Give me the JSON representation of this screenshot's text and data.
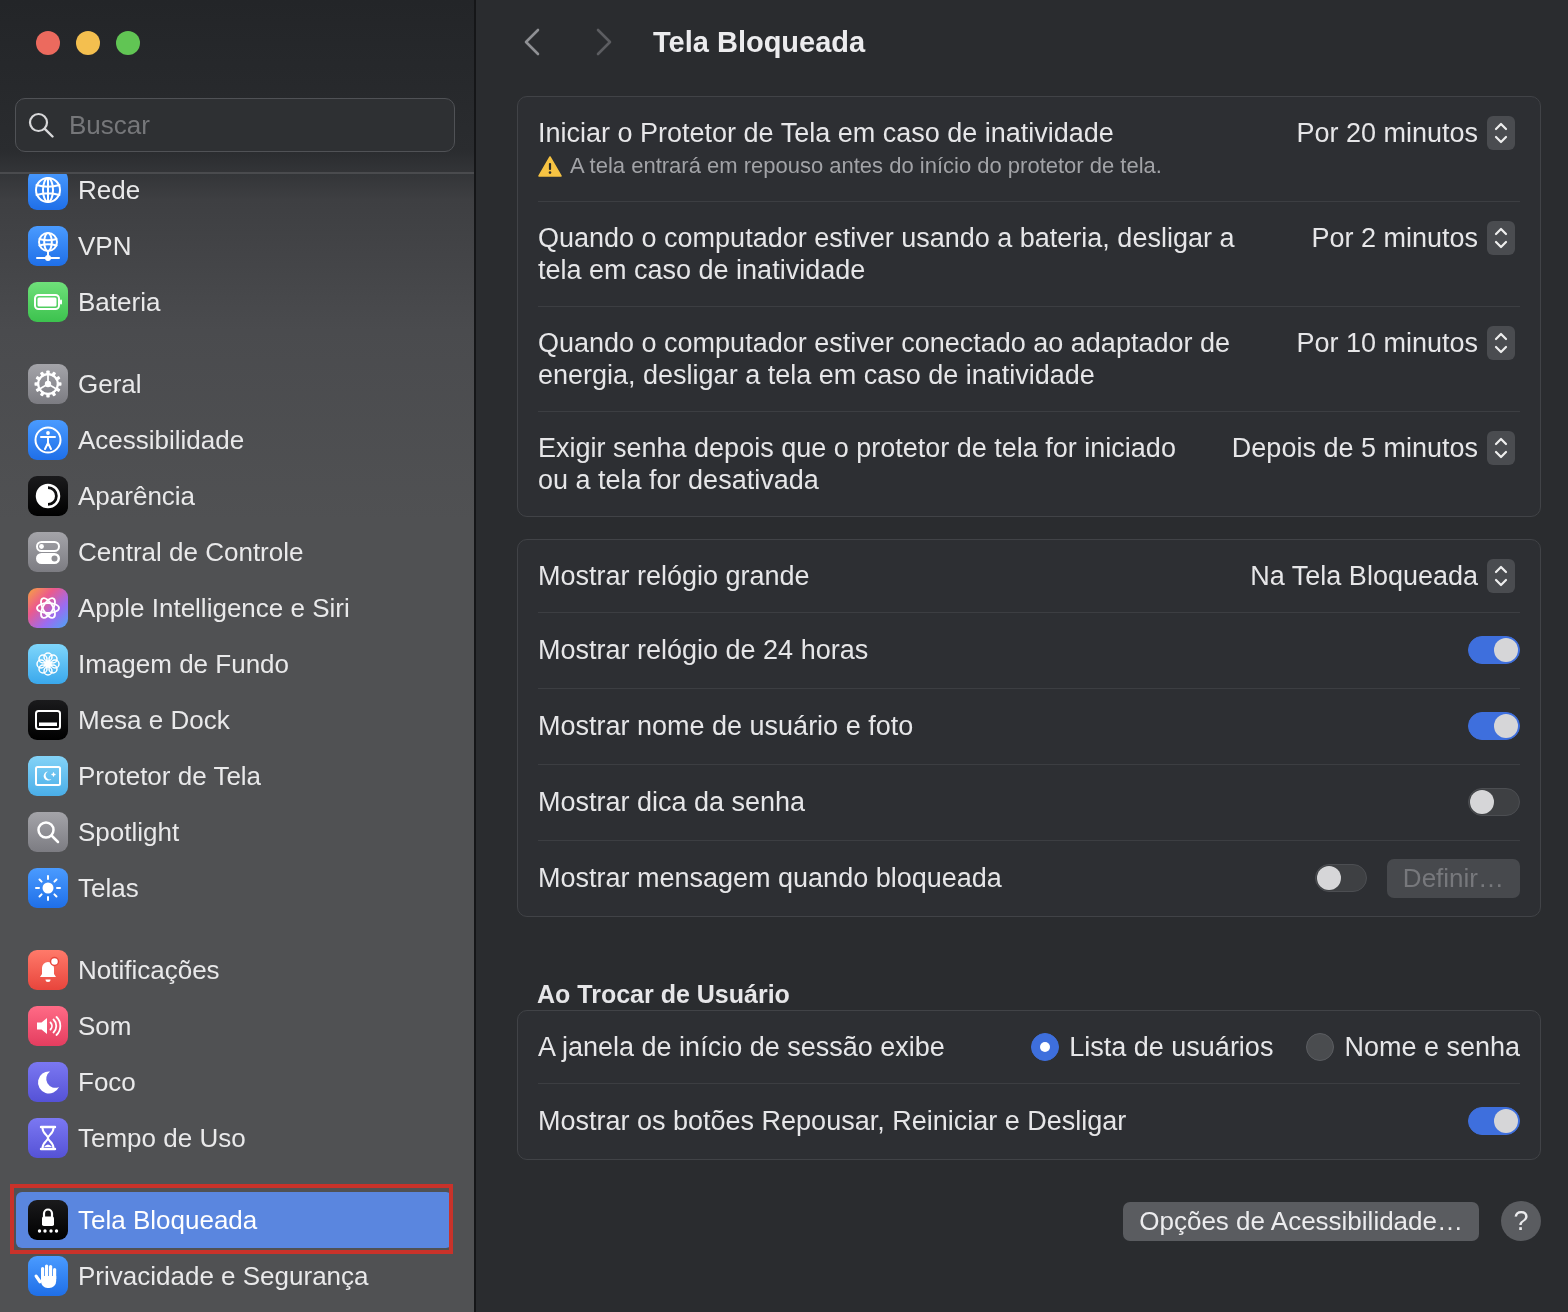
{
  "sidebar": {
    "search": {
      "placeholder": "Buscar"
    },
    "groups": [
      {
        "items": [
          {
            "label": "Rede",
            "selected": false,
            "highlighted": false
          },
          {
            "label": "VPN",
            "selected": false,
            "highlighted": false
          },
          {
            "label": "Bateria",
            "selected": false,
            "highlighted": false
          }
        ]
      },
      {
        "items": [
          {
            "label": "Geral",
            "selected": false,
            "highlighted": false
          },
          {
            "label": "Acessibilidade",
            "selected": false,
            "highlighted": false
          },
          {
            "label": "Aparência",
            "selected": false,
            "highlighted": false
          },
          {
            "label": "Central de Controle",
            "selected": false,
            "highlighted": false
          },
          {
            "label": "Apple Intelligence e Siri",
            "selected": false,
            "highlighted": false
          },
          {
            "label": "Imagem de Fundo",
            "selected": false,
            "highlighted": false
          },
          {
            "label": "Mesa e Dock",
            "selected": false,
            "highlighted": false
          },
          {
            "label": "Protetor de Tela",
            "selected": false,
            "highlighted": false
          },
          {
            "label": "Spotlight",
            "selected": false,
            "highlighted": false
          },
          {
            "label": "Telas",
            "selected": false,
            "highlighted": false
          }
        ]
      },
      {
        "items": [
          {
            "label": "Notificações",
            "selected": false,
            "highlighted": false
          },
          {
            "label": "Som",
            "selected": false,
            "highlighted": false
          },
          {
            "label": "Foco",
            "selected": false,
            "highlighted": false
          },
          {
            "label": "Tempo de Uso",
            "selected": false,
            "highlighted": false
          }
        ]
      },
      {
        "items": [
          {
            "label": "Tela Bloqueada",
            "selected": true,
            "highlighted": true
          },
          {
            "label": "Privacidade e Segurança",
            "selected": false,
            "highlighted": false
          }
        ]
      }
    ]
  },
  "header": {
    "back": {
      "disabled": false
    },
    "forward": {
      "disabled": true
    },
    "title": "Tela Bloqueada"
  },
  "sections": [
    {
      "rows": [
        {
          "kind": "popup",
          "label": "Iniciar o Protetor de Tela em caso de inatividade",
          "note": "A tela entrará em repouso antes do início do protetor de tela.",
          "value": "Por 20 minutos"
        },
        {
          "kind": "popup",
          "label": "Quando o computador estiver usando a bateria, desligar a tela em caso de inatividade",
          "value": "Por 2 minutos"
        },
        {
          "kind": "popup",
          "label": "Quando o computador estiver conectado ao adaptador de energia, desligar a tela em caso de inatividade",
          "value": "Por 10 minutos"
        },
        {
          "kind": "popup",
          "label": "Exigir senha depois que o protetor de tela for iniciado ou a tela for desativada",
          "value": "Depois de 5 minutos"
        }
      ]
    },
    {
      "rows": [
        {
          "kind": "popup",
          "label": "Mostrar relógio grande",
          "value": "Na Tela Bloqueada"
        },
        {
          "kind": "toggle",
          "label": "Mostrar relógio de 24 horas",
          "on": true
        },
        {
          "kind": "toggle",
          "label": "Mostrar nome de usuário e foto",
          "on": true
        },
        {
          "kind": "toggle",
          "label": "Mostrar dica da senha",
          "on": false
        },
        {
          "kind": "toggle",
          "label": "Mostrar mensagem quando bloqueada",
          "on": false,
          "button": {
            "label": "Definir…",
            "disabled": true
          }
        }
      ]
    },
    {
      "heading": "Ao Trocar de Usuário",
      "rows": [
        {
          "kind": "radio",
          "label": "A janela de início de sessão exibe",
          "options": [
            {
              "label": "Lista de usuários",
              "selected": true
            },
            {
              "label": "Nome e senha",
              "selected": false
            }
          ]
        },
        {
          "kind": "toggle",
          "label": "Mostrar os botões Repousar, Reiniciar e Desligar",
          "on": true
        }
      ]
    }
  ],
  "footer": {
    "button": "Opções de Acessibilidade…",
    "help": "?"
  }
}
